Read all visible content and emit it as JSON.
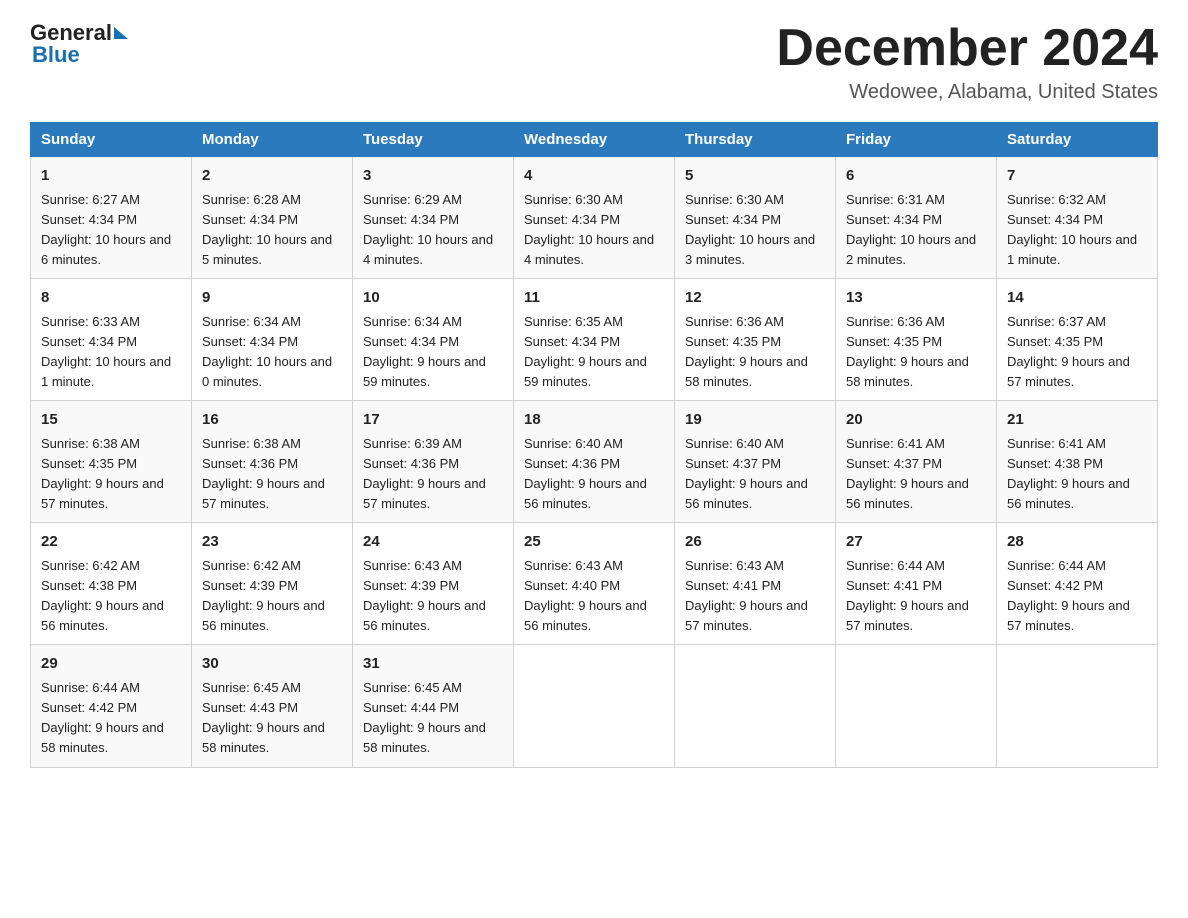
{
  "header": {
    "logo_general": "General",
    "logo_blue": "Blue",
    "title": "December 2024",
    "subtitle": "Wedowee, Alabama, United States"
  },
  "days_of_week": [
    "Sunday",
    "Monday",
    "Tuesday",
    "Wednesday",
    "Thursday",
    "Friday",
    "Saturday"
  ],
  "weeks": [
    [
      {
        "day": "1",
        "sunrise": "6:27 AM",
        "sunset": "4:34 PM",
        "daylight": "10 hours and 6 minutes."
      },
      {
        "day": "2",
        "sunrise": "6:28 AM",
        "sunset": "4:34 PM",
        "daylight": "10 hours and 5 minutes."
      },
      {
        "day": "3",
        "sunrise": "6:29 AM",
        "sunset": "4:34 PM",
        "daylight": "10 hours and 4 minutes."
      },
      {
        "day": "4",
        "sunrise": "6:30 AM",
        "sunset": "4:34 PM",
        "daylight": "10 hours and 4 minutes."
      },
      {
        "day": "5",
        "sunrise": "6:30 AM",
        "sunset": "4:34 PM",
        "daylight": "10 hours and 3 minutes."
      },
      {
        "day": "6",
        "sunrise": "6:31 AM",
        "sunset": "4:34 PM",
        "daylight": "10 hours and 2 minutes."
      },
      {
        "day": "7",
        "sunrise": "6:32 AM",
        "sunset": "4:34 PM",
        "daylight": "10 hours and 1 minute."
      }
    ],
    [
      {
        "day": "8",
        "sunrise": "6:33 AM",
        "sunset": "4:34 PM",
        "daylight": "10 hours and 1 minute."
      },
      {
        "day": "9",
        "sunrise": "6:34 AM",
        "sunset": "4:34 PM",
        "daylight": "10 hours and 0 minutes."
      },
      {
        "day": "10",
        "sunrise": "6:34 AM",
        "sunset": "4:34 PM",
        "daylight": "9 hours and 59 minutes."
      },
      {
        "day": "11",
        "sunrise": "6:35 AM",
        "sunset": "4:34 PM",
        "daylight": "9 hours and 59 minutes."
      },
      {
        "day": "12",
        "sunrise": "6:36 AM",
        "sunset": "4:35 PM",
        "daylight": "9 hours and 58 minutes."
      },
      {
        "day": "13",
        "sunrise": "6:36 AM",
        "sunset": "4:35 PM",
        "daylight": "9 hours and 58 minutes."
      },
      {
        "day": "14",
        "sunrise": "6:37 AM",
        "sunset": "4:35 PM",
        "daylight": "9 hours and 57 minutes."
      }
    ],
    [
      {
        "day": "15",
        "sunrise": "6:38 AM",
        "sunset": "4:35 PM",
        "daylight": "9 hours and 57 minutes."
      },
      {
        "day": "16",
        "sunrise": "6:38 AM",
        "sunset": "4:36 PM",
        "daylight": "9 hours and 57 minutes."
      },
      {
        "day": "17",
        "sunrise": "6:39 AM",
        "sunset": "4:36 PM",
        "daylight": "9 hours and 57 minutes."
      },
      {
        "day": "18",
        "sunrise": "6:40 AM",
        "sunset": "4:36 PM",
        "daylight": "9 hours and 56 minutes."
      },
      {
        "day": "19",
        "sunrise": "6:40 AM",
        "sunset": "4:37 PM",
        "daylight": "9 hours and 56 minutes."
      },
      {
        "day": "20",
        "sunrise": "6:41 AM",
        "sunset": "4:37 PM",
        "daylight": "9 hours and 56 minutes."
      },
      {
        "day": "21",
        "sunrise": "6:41 AM",
        "sunset": "4:38 PM",
        "daylight": "9 hours and 56 minutes."
      }
    ],
    [
      {
        "day": "22",
        "sunrise": "6:42 AM",
        "sunset": "4:38 PM",
        "daylight": "9 hours and 56 minutes."
      },
      {
        "day": "23",
        "sunrise": "6:42 AM",
        "sunset": "4:39 PM",
        "daylight": "9 hours and 56 minutes."
      },
      {
        "day": "24",
        "sunrise": "6:43 AM",
        "sunset": "4:39 PM",
        "daylight": "9 hours and 56 minutes."
      },
      {
        "day": "25",
        "sunrise": "6:43 AM",
        "sunset": "4:40 PM",
        "daylight": "9 hours and 56 minutes."
      },
      {
        "day": "26",
        "sunrise": "6:43 AM",
        "sunset": "4:41 PM",
        "daylight": "9 hours and 57 minutes."
      },
      {
        "day": "27",
        "sunrise": "6:44 AM",
        "sunset": "4:41 PM",
        "daylight": "9 hours and 57 minutes."
      },
      {
        "day": "28",
        "sunrise": "6:44 AM",
        "sunset": "4:42 PM",
        "daylight": "9 hours and 57 minutes."
      }
    ],
    [
      {
        "day": "29",
        "sunrise": "6:44 AM",
        "sunset": "4:42 PM",
        "daylight": "9 hours and 58 minutes."
      },
      {
        "day": "30",
        "sunrise": "6:45 AM",
        "sunset": "4:43 PM",
        "daylight": "9 hours and 58 minutes."
      },
      {
        "day": "31",
        "sunrise": "6:45 AM",
        "sunset": "4:44 PM",
        "daylight": "9 hours and 58 minutes."
      },
      null,
      null,
      null,
      null
    ]
  ],
  "labels": {
    "sunrise": "Sunrise:",
    "sunset": "Sunset:",
    "daylight": "Daylight:"
  }
}
